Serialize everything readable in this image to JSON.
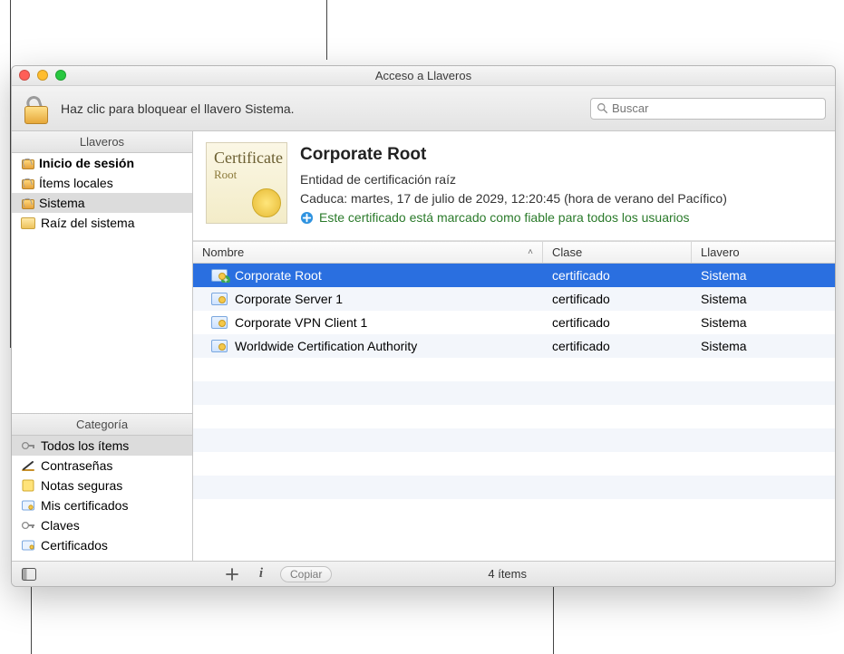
{
  "window": {
    "title": "Acceso a Llaveros",
    "lock_hint": "Haz clic para bloquear el llavero Sistema.",
    "search_placeholder": "Buscar"
  },
  "sidebar": {
    "keychains_header": "Llaveros",
    "category_header": "Categoría",
    "keychains": [
      {
        "label": "Inicio de sesión",
        "icon": "lock-open",
        "bold": true,
        "selected": false
      },
      {
        "label": "Ítems locales",
        "icon": "lock-open",
        "bold": false,
        "selected": false
      },
      {
        "label": "Sistema",
        "icon": "lock-open",
        "bold": false,
        "selected": true
      },
      {
        "label": "Raíz del sistema",
        "icon": "folder",
        "bold": false,
        "selected": false
      }
    ],
    "categories": [
      {
        "label": "Todos los ítems",
        "icon": "all",
        "selected": true
      },
      {
        "label": "Contraseñas",
        "icon": "password",
        "selected": false
      },
      {
        "label": "Notas seguras",
        "icon": "note",
        "selected": false
      },
      {
        "label": "Mis certificados",
        "icon": "mycerts",
        "selected": false
      },
      {
        "label": "Claves",
        "icon": "keys",
        "selected": false
      },
      {
        "label": "Certificados",
        "icon": "certs",
        "selected": false
      }
    ]
  },
  "detail": {
    "badge_title": "Certificate",
    "badge_sub": "Root",
    "title": "Corporate Root",
    "subtitle": "Entidad de certificación raíz",
    "expiry": "Caduca: martes, 17 de julio de 2029, 12:20:45 (hora de verano del Pacífico)",
    "trust": "Este certificado está marcado como fiable para todos los usuarios"
  },
  "table": {
    "columns": {
      "name": "Nombre",
      "class": "Clase",
      "keychain": "Llavero"
    },
    "sort_column": "name",
    "sort_dir": "asc",
    "rows": [
      {
        "name": "Corporate Root",
        "class": "certificado",
        "keychain": "Sistema",
        "selected": true,
        "plus": true
      },
      {
        "name": "Corporate Server 1",
        "class": "certificado",
        "keychain": "Sistema",
        "selected": false,
        "plus": false
      },
      {
        "name": "Corporate VPN Client 1",
        "class": "certificado",
        "keychain": "Sistema",
        "selected": false,
        "plus": false
      },
      {
        "name": "Worldwide Certification Authority",
        "class": "certificado",
        "keychain": "Sistema",
        "selected": false,
        "plus": false
      }
    ]
  },
  "status": {
    "copy_label": "Copiar",
    "item_count": "4 ítems"
  },
  "colors": {
    "selection": "#2a6fe0",
    "trust_text": "#2a7a2a"
  }
}
